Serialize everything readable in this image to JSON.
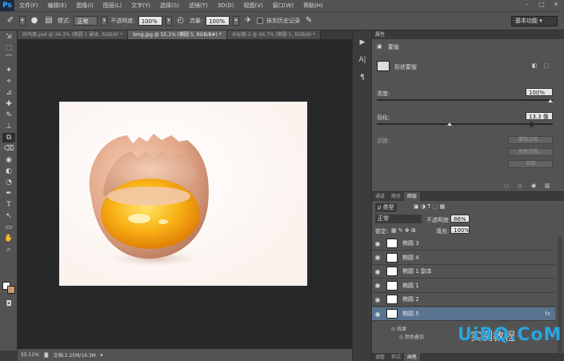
{
  "app": {
    "logo": "Ps"
  },
  "menu": [
    "文件(F)",
    "编辑(E)",
    "图像(I)",
    "图层(L)",
    "文字(Y)",
    "选择(S)",
    "滤镜(T)",
    "3D(D)",
    "视图(V)",
    "窗口(W)",
    "帮助(H)"
  ],
  "window_controls": [
    "–",
    "□",
    "✕"
  ],
  "options": {
    "mode_label": "模式:",
    "mode_value": "正常",
    "opacity_label": "不透明度:",
    "opacity_value": "100%",
    "flow_label": "流量:",
    "flow_value": "100%",
    "history_label": "抹到历史记录",
    "workspace": "基本功能"
  },
  "tabs": [
    "碎鸡蛋.psd @ 34.3% (椭圆 1 副本, RGB/8) *",
    "bmg.jpg @ 55.1% (椭圆 5, RGB/8#) *",
    "未标题-2 @ 66.7% (椭圆 1, RGB/8) *"
  ],
  "tools": [
    "⇲",
    "⬚",
    "⌒",
    "✦",
    "⌖",
    "⊿",
    "✚",
    "✎",
    "⊥",
    "⧉",
    "⌫",
    "◉",
    "◐",
    "◔",
    "✒",
    "T",
    "↖",
    "▭",
    "✋",
    "⌕"
  ],
  "status": {
    "zoom": "55.11%",
    "doc": "文档:2.25M/19.3M"
  },
  "properties": {
    "header": "属性",
    "title": "蒙版",
    "mask_type": "形状蒙版",
    "density_label": "浓度:",
    "density_value": "100%",
    "feather_label": "羽化:",
    "feather_value": "13.3 像素",
    "adjust_label": "调整:",
    "btn_edge": "蒙版边缘...",
    "btn_color": "颜色范围...",
    "btn_invert": "反相"
  },
  "layers_panel": {
    "tabs": [
      "通道",
      "路径",
      "图层"
    ],
    "filter_label": "ρ 类型",
    "blend_mode": "正常",
    "opacity_label": "不透明度:",
    "opacity_value": "86%",
    "lock_label": "锁定:",
    "fill_label": "填充:",
    "fill_value": "100%",
    "layers": [
      {
        "name": "椭圆 3",
        "selected": false,
        "fx": ""
      },
      {
        "name": "椭圆 4",
        "selected": false,
        "fx": ""
      },
      {
        "name": "椭圆 1 副本",
        "selected": false,
        "fx": ""
      },
      {
        "name": "椭圆 1",
        "selected": false,
        "fx": ""
      },
      {
        "name": "椭圆 2",
        "selected": false,
        "fx": ""
      },
      {
        "name": "椭圆 5",
        "selected": true,
        "fx": "fx"
      }
    ],
    "effect_label": "效果",
    "effect_item": "颜色叠加",
    "bottom_tabs": [
      "调整",
      "样式",
      "画笔"
    ]
  },
  "watermark": {
    "brand": "UiBQ.CoM",
    "sub": "实例教程"
  },
  "colors": {
    "accent": "#29a5e0",
    "selected_layer": "#5a7391",
    "bg_swatch": "#c49a6c"
  }
}
